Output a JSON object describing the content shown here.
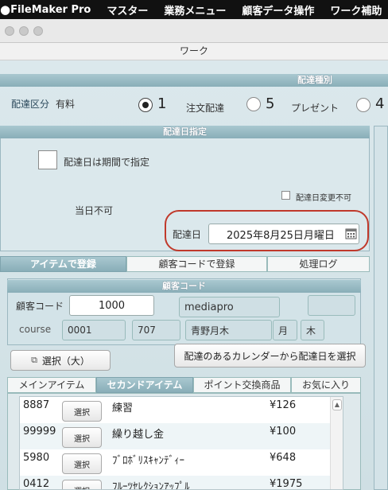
{
  "menubar": {
    "apple": "",
    "items": [
      "FileMaker Pro",
      "マスター",
      "業務メニュー",
      "顧客データ操作",
      "ワーク補助"
    ]
  },
  "window": {
    "subtitle": "ワーク"
  },
  "delivery_type": {
    "section_title": "配達種別",
    "label": "配達区分",
    "value": "有料",
    "options": [
      {
        "num": "1",
        "label": "注文配達",
        "selected": true
      },
      {
        "num": "5",
        "label": "プレゼント",
        "selected": false
      },
      {
        "num": "4",
        "label": "",
        "selected": false
      }
    ]
  },
  "delivery_date": {
    "section_title": "配達日指定",
    "period_checkbox_label": "配達日は期間で指定",
    "unchangeable_label": "配達日変更不可",
    "same_day_note": "当日不可",
    "date_label": "配達日",
    "date_value": "2025年8月25日月曜日",
    "calendar_icon": "calendar-icon"
  },
  "main_tabs": [
    "アイテムで登録",
    "顧客コードで登録",
    "処理ログ"
  ],
  "customer": {
    "section_title": "顧客コード",
    "code_label": "顧客コード",
    "code_value": "1000",
    "name_value": "mediapro",
    "course_label": "course",
    "course_code": "0001",
    "route_code": "707",
    "route_name": "青野月木",
    "day1": "月",
    "day2": "木"
  },
  "buttons": {
    "select_large": "選択（大）",
    "select_from_calendar": "配達のあるカレンダーから配達日を選択"
  },
  "item_tabs": [
    "メインアイテム",
    "セカンドアイテム",
    "ポイント交換商品",
    "お気に入り"
  ],
  "items": [
    {
      "code": "8887",
      "select": "選択",
      "name": "練習",
      "price": "¥126"
    },
    {
      "code": "99999",
      "select": "選択",
      "name": "繰り越し金",
      "price": "¥100"
    },
    {
      "code": "5980",
      "select": "選択",
      "name": "ﾌﾞﾛﾎﾞﾘｽｷｬﾝﾃﾞｨｰ",
      "price": "¥648"
    },
    {
      "code": "0412",
      "select": "選択",
      "name": "ﾌﾙｰﾂｾﾚｸｼｮﾝｱｯﾌﾟﾙ",
      "price": "¥1975"
    }
  ],
  "colors": {
    "accent_strip": "#89aeb8",
    "highlight_oval": "#c0392b"
  }
}
